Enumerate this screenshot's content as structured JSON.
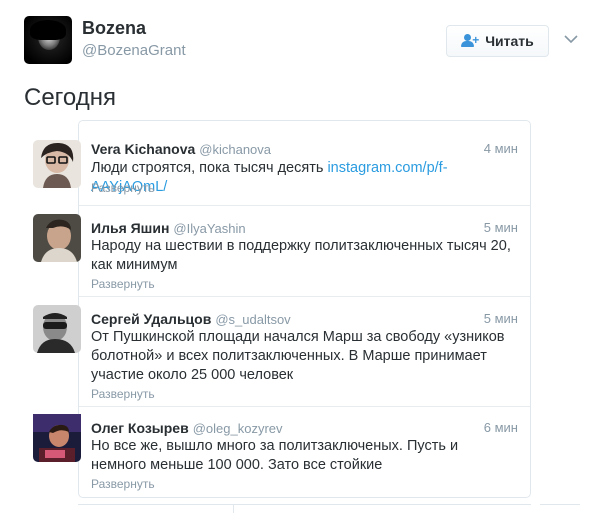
{
  "profile": {
    "name": "Bozena",
    "handle": "@BozenaGrant",
    "follow_label": "Читать"
  },
  "section_title": "Сегодня",
  "tweets": [
    {
      "name": "Vera Kichanova",
      "handle": "@kichanova",
      "time": "4 мин",
      "text": "Люди строятся, пока тысяч десять ",
      "link": "instagram.com/p/f-AAYjAOmL/",
      "expand": "Развернуть"
    },
    {
      "name": "Илья Яшин",
      "handle": "@IlyaYashin",
      "time": "5 мин",
      "text": "Народу на шествии в поддержку политзаключенных тысяч 20, как минимум",
      "expand": "Развернуть"
    },
    {
      "name": "Сергей Удальцов",
      "handle": "@s_udaltsov",
      "time": "5 мин",
      "text": "От Пушкинской площади начался Марш за свободу «узников болотной» и всех политзаключенных. В Марше принимает участие около 25 000 человек",
      "expand": "Развернуть"
    },
    {
      "name": "Олег Козырев",
      "handle": "@oleg_kozyrev",
      "time": "6 мин",
      "text": "Но все же, вышло много за политзаключеных. Пусть и немного меньше 100 000. Зато все стойкие",
      "expand": "Развернуть"
    }
  ],
  "colors": {
    "accent": "#3b94d9",
    "link": "#2b9ce0",
    "muted": "#8899a6",
    "text": "#292f33"
  },
  "icons": {
    "follow": "user-plus-icon",
    "more": "chevron-down-icon"
  }
}
